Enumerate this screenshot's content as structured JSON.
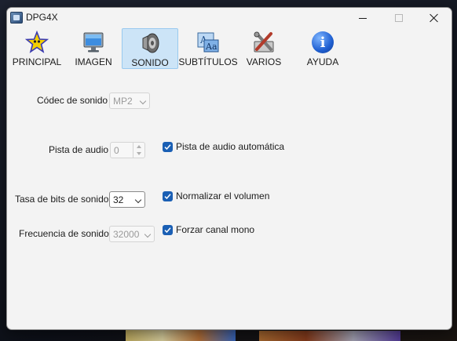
{
  "window": {
    "title": "DPG4X"
  },
  "toolbar": {
    "tabs": [
      {
        "label": "PRINCIPAL",
        "icon": "star-icon",
        "active": false
      },
      {
        "label": "IMAGEN",
        "icon": "monitor-icon",
        "active": false
      },
      {
        "label": "SONIDO",
        "icon": "speaker-icon",
        "active": true
      },
      {
        "label": "SUBTÍTULOS",
        "icon": "subtitles-icon",
        "active": false
      },
      {
        "label": "VARIOS",
        "icon": "tools-icon",
        "active": false
      },
      {
        "label": "AYUDA",
        "icon": "info-icon",
        "active": false
      }
    ]
  },
  "sound": {
    "codec": {
      "label": "Códec de sonido",
      "value": "MP2",
      "enabled": false
    },
    "audio_track": {
      "label": "Pista de audio",
      "value": "0",
      "enabled": false
    },
    "auto_track": {
      "label": "Pista de audio automática",
      "checked": true
    },
    "bitrate": {
      "label": "Tasa de bits de sonido",
      "value": "32",
      "enabled": true
    },
    "normalize": {
      "label": "Normalizar el volumen",
      "checked": true
    },
    "frequency": {
      "label": "Frecuencia de sonido",
      "value": "32000",
      "enabled": false
    },
    "mono": {
      "label": "Forzar canal mono",
      "checked": true
    }
  },
  "colors": {
    "accent": "#1a5fb4",
    "active_tab_bg": "#cce4f7"
  }
}
